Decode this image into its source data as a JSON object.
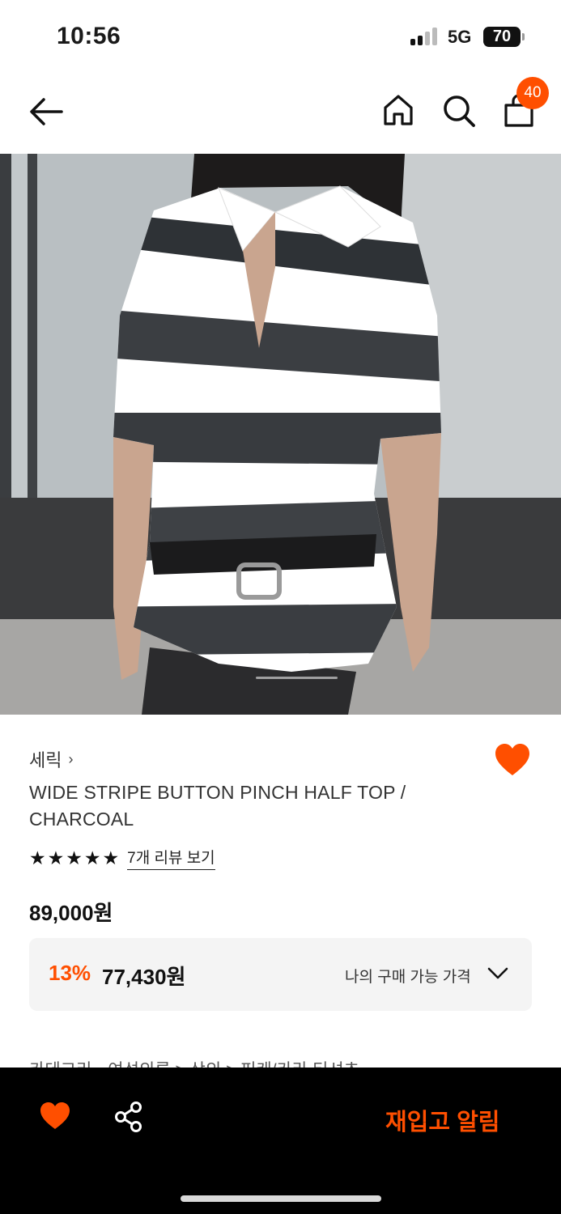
{
  "status_bar": {
    "time": "10:56",
    "network": "5G",
    "battery": "70"
  },
  "nav": {
    "cart_count": "40",
    "icons": [
      "back-arrow-icon",
      "home-icon",
      "search-icon",
      "shopping-bag-icon"
    ]
  },
  "product": {
    "brand": "세릭",
    "brand_chevron": "›",
    "name": "WIDE STRIPE BUTTON PINCH HALF TOP / CHARCOAL",
    "rating_stars": 5,
    "review_link": "7개 리뷰 보기",
    "price": "89,000원",
    "discount": {
      "rate": "13%",
      "price": "77,430원",
      "my_price_label": "나의 구매 가능 가격"
    },
    "category_label": "카테고리",
    "category_path": "여성의류 > 상의 > 피케/카라 티셔츠"
  },
  "bottom_bar": {
    "restock_label": "재입고 알림"
  },
  "colors": {
    "accent": "#ff4f00",
    "bottom_bar": "#000000",
    "price_box": "#f4f4f4"
  }
}
